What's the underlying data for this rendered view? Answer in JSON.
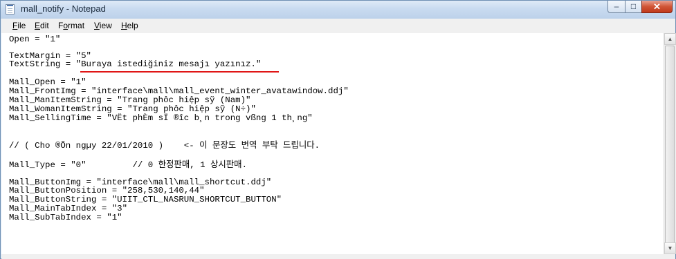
{
  "window": {
    "title": "mall_notify - Notepad",
    "controls": {
      "minimize": "–",
      "maximize": "□",
      "close": "✕"
    }
  },
  "menu": {
    "items": [
      {
        "label": "File",
        "underline": "F",
        "rest": "ile"
      },
      {
        "label": "Edit",
        "underline": "E",
        "rest": "dit"
      },
      {
        "label": "Format",
        "underline": "o",
        "prefix": "F",
        "rest": "rmat"
      },
      {
        "label": "View",
        "underline": "V",
        "rest": "iew"
      },
      {
        "label": "Help",
        "underline": "H",
        "rest": "elp"
      }
    ]
  },
  "editor": {
    "lines": [
      "Open = \"1\"",
      "",
      "TextMargin = \"5\"",
      "TextString = \"Buraya istediğiniz mesajı yazınız.\"",
      "",
      "Mall_Open = \"1\"",
      "Mall_FrontImg = \"interface\\mall\\mall_event_winter_avatawindow.ddj\"",
      "Mall_ManItemString = \"Trang phôc hiệp sỹ (Nam)\"",
      "Mall_WomanItemString = \"Trang phôc hiệp sỹ (N÷)\"",
      "Mall_SellingTime = \"VËt phÈm sÏ ®­îc b¸n trong vßng 1 th¸ng\"",
      "",
      "",
      "// ( Cho ®Õn ngµy 22/01/2010 )    <- 이 문장도 번역 부탁 드립니다.",
      "",
      "Mall_Type = \"0\"         // 0 한정판매, 1 상시판매.",
      "",
      "Mall_ButtonImg = \"interface\\mall\\mall_shortcut.ddj\"",
      "Mall_ButtonPosition = \"258,530,140,44\"",
      "Mall_ButtonString = \"UIIT_CTL_NASRUN_SHORTCUT_BUTTON\"",
      "Mall_MainTabIndex = \"3\"",
      "Mall_SubTabIndex = \"1\""
    ],
    "highlight_color": "#e01616"
  },
  "scrollbar": {
    "up": "▲",
    "down": "▼"
  }
}
